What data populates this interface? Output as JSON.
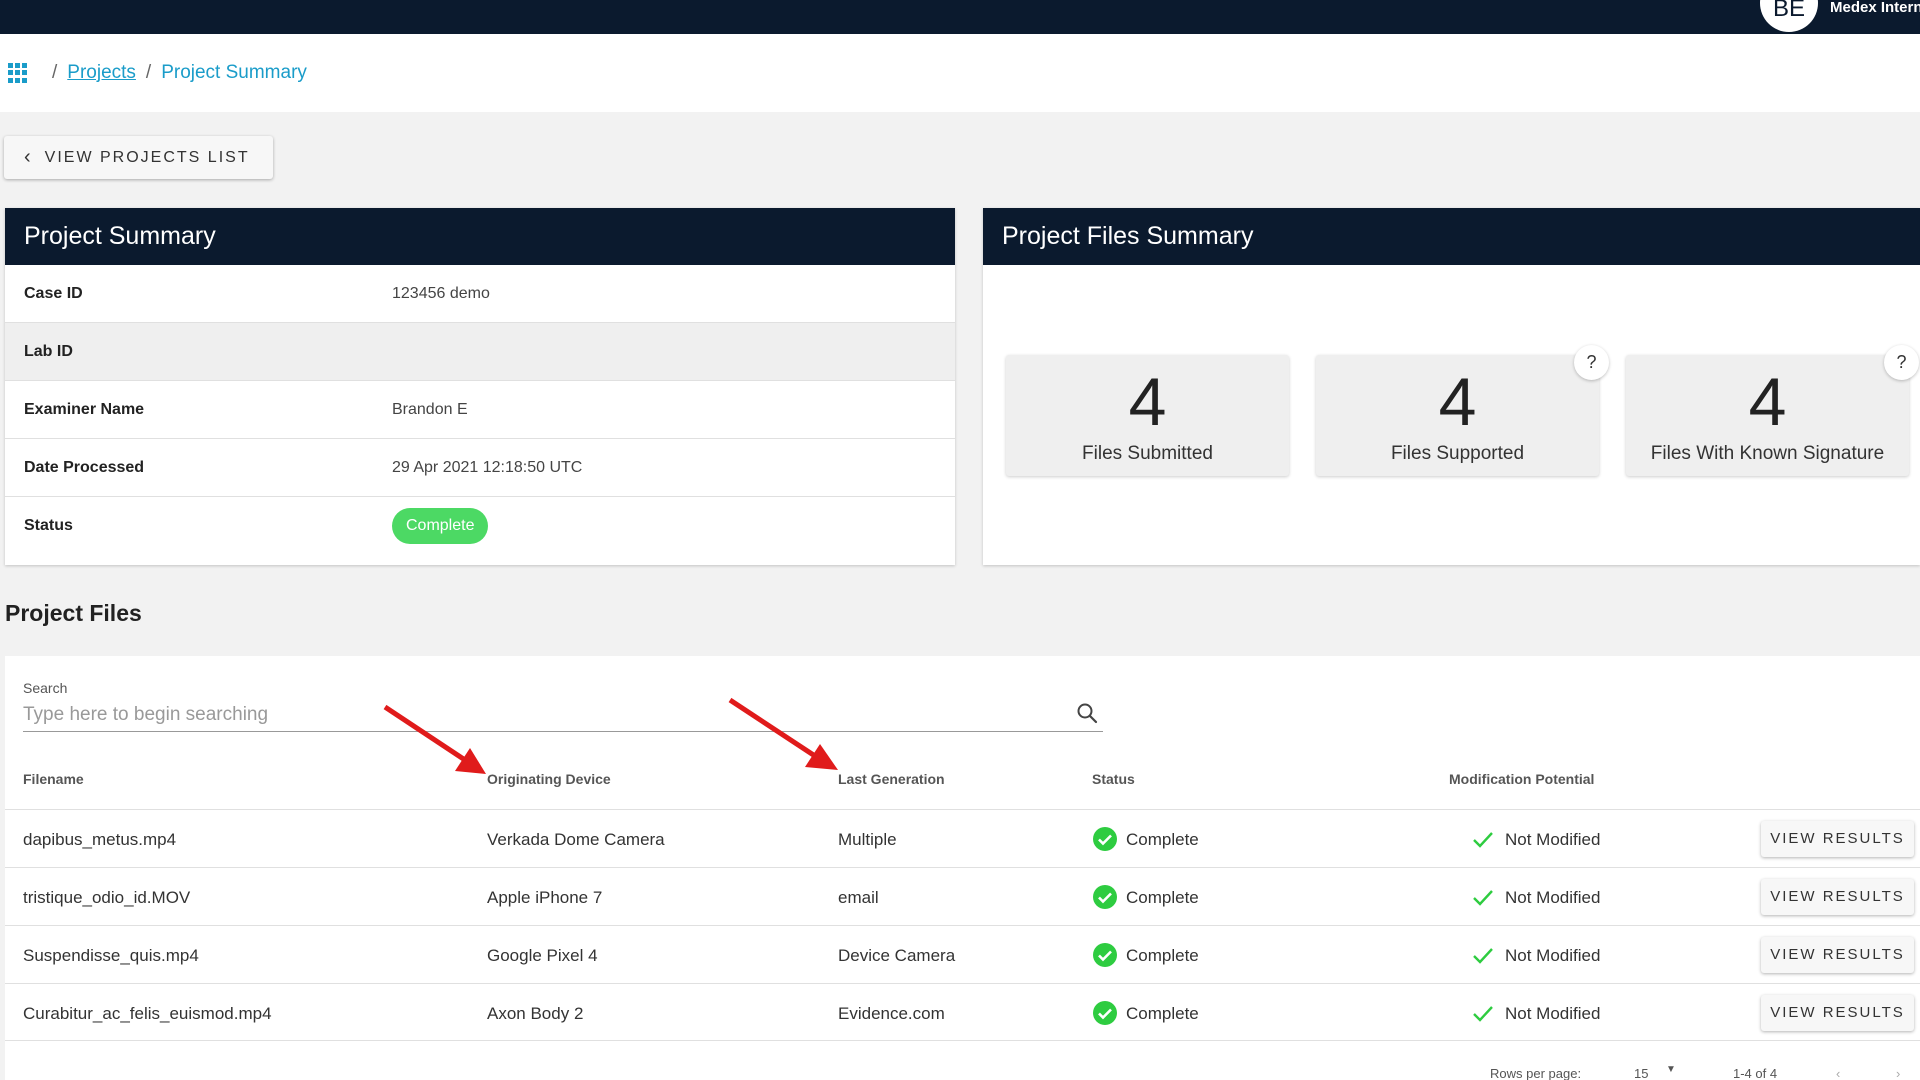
{
  "header": {
    "avatar_initials": "BE",
    "org_name": "Medex Intern"
  },
  "breadcrumb": {
    "projects": "Projects",
    "current": "Project Summary",
    "separator": "/"
  },
  "back_button": "VIEW PROJECTS LIST",
  "project_summary": {
    "title": "Project Summary",
    "rows": [
      {
        "label": "Case ID",
        "value": "123456 demo"
      },
      {
        "label": "Lab ID",
        "value": ""
      },
      {
        "label": "Examiner Name",
        "value": "Brandon E"
      },
      {
        "label": "Date Processed",
        "value": "29 Apr 2021 12:18:50 UTC"
      },
      {
        "label": "Status",
        "value": "Complete"
      }
    ]
  },
  "files_summary": {
    "title": "Project Files Summary",
    "stats": [
      {
        "value": "4",
        "label": "Files Submitted"
      },
      {
        "value": "4",
        "label": "Files Supported",
        "help": "?"
      },
      {
        "value": "4",
        "label": "Files With Known Signature",
        "help": "?"
      }
    ]
  },
  "project_files": {
    "title": "Project Files",
    "search": {
      "label": "Search",
      "placeholder": "Type here to begin searching"
    },
    "columns": [
      "Filename",
      "Originating Device",
      "Last Generation",
      "Status",
      "Modification Potential"
    ],
    "rows": [
      {
        "filename": "dapibus_metus.mp4",
        "device": "Verkada Dome Camera",
        "generation": "Multiple",
        "status": "Complete",
        "modification": "Not Modified",
        "action": "VIEW RESULTS"
      },
      {
        "filename": "tristique_odio_id.MOV",
        "device": "Apple iPhone 7",
        "generation": "email",
        "status": "Complete",
        "modification": "Not Modified",
        "action": "VIEW RESULTS"
      },
      {
        "filename": "Suspendisse_quis.mp4",
        "device": "Google Pixel 4",
        "generation": "Device Camera",
        "status": "Complete",
        "modification": "Not Modified",
        "action": "VIEW RESULTS"
      },
      {
        "filename": "Curabitur_ac_felis_euismod.mp4",
        "device": "Axon Body 2",
        "generation": "Evidence.com",
        "status": "Complete",
        "modification": "Not Modified",
        "action": "VIEW RESULTS"
      }
    ],
    "pagination": {
      "rows_per_page_label": "Rows per page:",
      "rows_per_page": "15",
      "range": "1-4 of 4"
    }
  },
  "colors": {
    "nav": "#0b1a2e",
    "link": "#1a9cc9",
    "success": "#4cd964",
    "annotation": "#e01b1b"
  },
  "icons": [
    "apps-grid-icon",
    "chevron-left-icon",
    "search-icon",
    "check-circle-icon",
    "check-icon",
    "help-icon",
    "dropdown-arrow-icon",
    "chevron-left-icon",
    "chevron-right-icon"
  ]
}
